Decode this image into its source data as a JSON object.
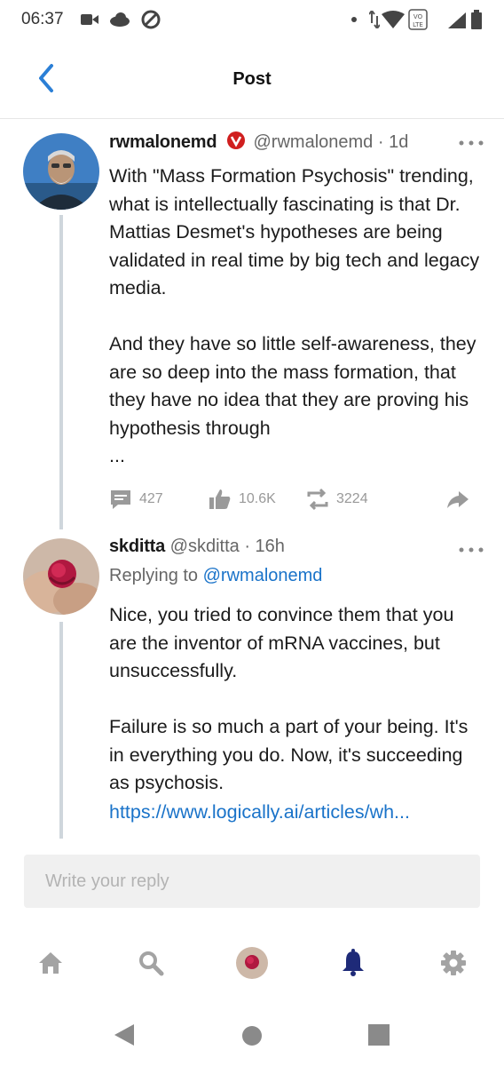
{
  "status_bar": {
    "time": "06:37"
  },
  "header": {
    "title": "Post"
  },
  "post": {
    "author_name": "rwmalonemd",
    "author_handle": "@rwmalonemd",
    "age": "· 1d",
    "body": "With \"Mass Formation Psychosis\" trending, what is intellectually fascinating is that Dr. Mattias Desmet's hypotheses are being validated in real time by big tech and legacy media.\n\nAnd they have so little self-awareness, they are so deep into the mass formation, that they have no idea that they are proving his hypothesis through\n...",
    "comments": "427",
    "likes": "10.6K",
    "reposts": "3224"
  },
  "reply": {
    "author_name": "skditta",
    "author_handle": "@skditta",
    "age": "· 16h",
    "replying_prefix": "Replying to ",
    "replying_to": "@rwmalonemd",
    "body": "Nice, you tried to convince them that you are the inventor of mRNA vaccines, but unsuccessfully.\n\nFailure is so much a part of your being. It's in everything you do. Now, it's succeeding as psychosis.",
    "link": "https://www.logically.ai/articles/wh..."
  },
  "composer": {
    "placeholder": "Write your reply"
  },
  "colors": {
    "accent": "#1a73c9",
    "verified_badge": "#d01f1f",
    "icon_gray": "#9a9a9a",
    "bell": "#1e2a78"
  }
}
